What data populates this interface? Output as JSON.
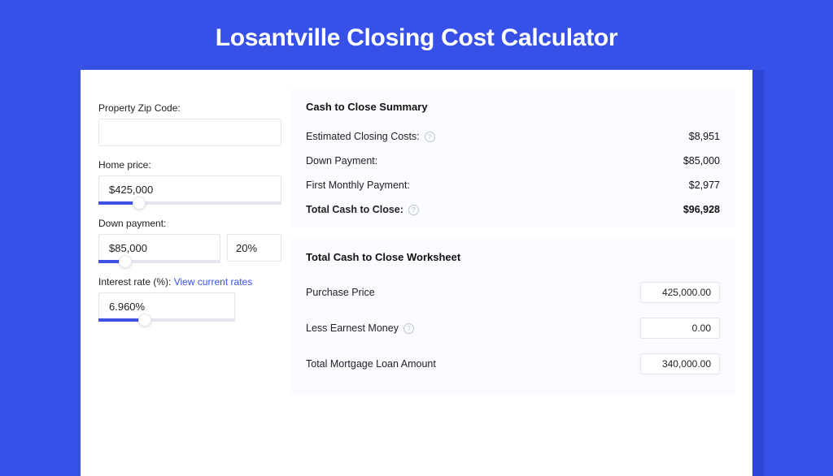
{
  "title": "Losantville Closing Cost Calculator",
  "colors": {
    "accent": "#3751e8",
    "panel": "#fafbff",
    "border": "#e4e6ef"
  },
  "left": {
    "zip": {
      "label": "Property Zip Code:",
      "value": ""
    },
    "home_price": {
      "label": "Home price:",
      "value": "$425,000",
      "slider_pct": 22
    },
    "down_payment": {
      "label": "Down payment:",
      "value": "$85,000",
      "pct": "20%",
      "slider_pct": 22
    },
    "interest": {
      "label": "Interest rate (%):",
      "link": "View current rates",
      "value": "6.960%",
      "slider_pct": 34
    }
  },
  "summary": {
    "title": "Cash to Close Summary",
    "rows": [
      {
        "label": "Estimated Closing Costs:",
        "value": "$8,951",
        "help": true
      },
      {
        "label": "Down Payment:",
        "value": "$85,000",
        "help": false
      },
      {
        "label": "First Monthly Payment:",
        "value": "$2,977",
        "help": false
      }
    ],
    "total": {
      "label": "Total Cash to Close:",
      "value": "$96,928",
      "help": true
    }
  },
  "worksheet": {
    "title": "Total Cash to Close Worksheet",
    "rows": [
      {
        "label": "Purchase Price",
        "value": "425,000.00",
        "help": false
      },
      {
        "label": "Less Earnest Money",
        "value": "0.00",
        "help": true
      },
      {
        "label": "Total Mortgage Loan Amount",
        "value": "340,000.00",
        "help": false
      }
    ]
  }
}
